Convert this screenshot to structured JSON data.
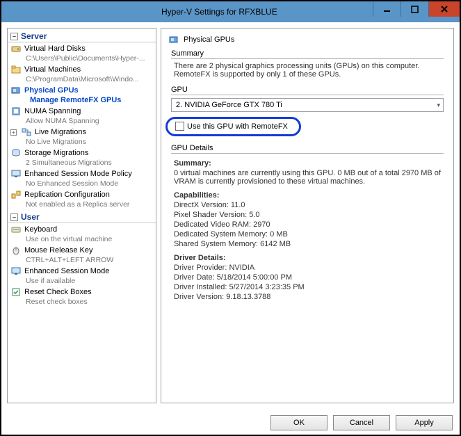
{
  "window": {
    "title": "Hyper-V Settings for RFXBLUE"
  },
  "sections": {
    "server": "Server",
    "user": "User"
  },
  "tree": {
    "vhd": {
      "label": "Virtual Hard Disks",
      "sub": "C:\\Users\\Public\\Documents\\Hyper-..."
    },
    "vm": {
      "label": "Virtual Machines",
      "sub": "C:\\ProgramData\\Microsoft\\Windo..."
    },
    "gpu": {
      "label": "Physical GPUs",
      "sub": "Manage RemoteFX GPUs"
    },
    "numa": {
      "label": "NUMA Spanning",
      "sub": "Allow NUMA Spanning"
    },
    "live": {
      "label": "Live Migrations",
      "sub": "No Live Migrations"
    },
    "storage": {
      "label": "Storage Migrations",
      "sub": "2 Simultaneous Migrations"
    },
    "esmp": {
      "label": "Enhanced Session Mode Policy",
      "sub": "No Enhanced Session Mode"
    },
    "repl": {
      "label": "Replication Configuration",
      "sub": "Not enabled as a Replica server"
    },
    "kb": {
      "label": "Keyboard",
      "sub": "Use on the virtual machine"
    },
    "mouse": {
      "label": "Mouse Release Key",
      "sub": "CTRL+ALT+LEFT ARROW"
    },
    "esm": {
      "label": "Enhanced Session Mode",
      "sub": "Use if available"
    },
    "reset": {
      "label": "Reset Check Boxes",
      "sub": "Reset check boxes"
    }
  },
  "right": {
    "heading": "Physical GPUs",
    "summary_title": "Summary",
    "summary_text": "There are 2 physical graphics processing units (GPUs) on this computer. RemoteFX is supported by only 1 of these GPUs.",
    "gpu_title": "GPU",
    "gpu_selected": "2. NVIDIA GeForce GTX 780 Ti",
    "use_checkbox": "Use this GPU with RemoteFX",
    "details_title": "GPU Details",
    "details": {
      "summary_label": "Summary:",
      "summary_text": "0 virtual machines are currently using this GPU. 0 MB out of a total 2970 MB of VRAM is currently provisioned to these virtual machines.",
      "caps_label": "Capabilities:",
      "caps": {
        "dx": "DirectX Version: 11.0",
        "ps": "Pixel Shader Version: 5.0",
        "vram": "Dedicated Video RAM: 2970",
        "dsm": "Dedicated System Memory: 0 MB",
        "ssm": "Shared System Memory: 6142 MB"
      },
      "drv_label": "Driver Details:",
      "drv": {
        "provider": "Driver Provider: NVIDIA",
        "date": "Driver Date: 5/18/2014 5:00:00 PM",
        "inst": "Driver Installed: 5/27/2014 3:23:35 PM",
        "ver": "Driver Version: 9.18.13.3788"
      }
    }
  },
  "buttons": {
    "ok": "OK",
    "cancel": "Cancel",
    "apply": "Apply"
  },
  "icons": {
    "gpu": "gpu-icon"
  }
}
